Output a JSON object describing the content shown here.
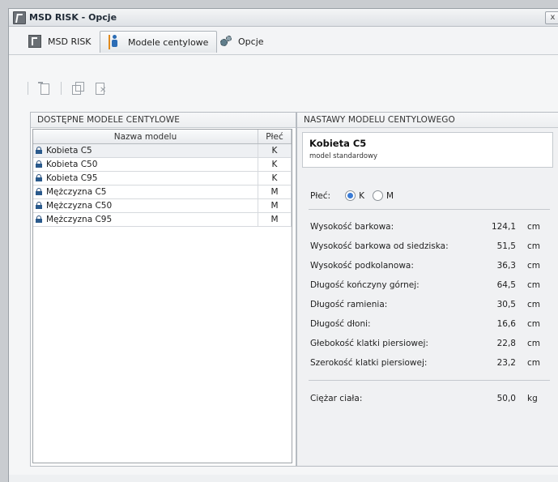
{
  "window": {
    "title": "MSD RISK - Opcje",
    "close_label": "x"
  },
  "tabs": [
    {
      "label": "MSD RISK",
      "icon": "msd-risk-icon"
    },
    {
      "label": "Modele centylowe",
      "icon": "model-icon"
    },
    {
      "label": "Opcje",
      "icon": "gears-icon"
    }
  ],
  "toolbar": {
    "icons": [
      "new-model-icon",
      "copy-icon",
      "delete-icon"
    ]
  },
  "left_panel": {
    "title": "DOSTĘPNE MODELE CENTYLOWE",
    "columns": [
      "Nazwa modelu",
      "Płeć"
    ],
    "rows": [
      {
        "name": "Kobieta C5",
        "sex": "K"
      },
      {
        "name": "Kobieta C50",
        "sex": "K"
      },
      {
        "name": "Kobieta C95",
        "sex": "K"
      },
      {
        "name": "Mężczyzna C5",
        "sex": "M"
      },
      {
        "name": "Mężczyzna C50",
        "sex": "M"
      },
      {
        "name": "Mężczyzna C95",
        "sex": "M"
      }
    ]
  },
  "right_panel": {
    "title": "NASTAWY MODELU CENTYLOWEGO",
    "model_name": "Kobieta C5",
    "model_desc": "model standardowy",
    "sex_label": "Płeć:",
    "sex_options": [
      "K",
      "M"
    ],
    "sex_selected": "K",
    "measurements": [
      {
        "label": "Wysokość barkowa:",
        "value": "124,1",
        "unit": "cm"
      },
      {
        "label": "Wysokość barkowa od siedziska:",
        "value": "51,5",
        "unit": "cm"
      },
      {
        "label": "Wysokość podkolanowa:",
        "value": "36,3",
        "unit": "cm"
      },
      {
        "label": "Długość kończyny górnej:",
        "value": "64,5",
        "unit": "cm"
      },
      {
        "label": "Długość ramienia:",
        "value": "30,5",
        "unit": "cm"
      },
      {
        "label": "Długość dłoni:",
        "value": "16,6",
        "unit": "cm"
      },
      {
        "label": "Głebokość klatki piersiowej:",
        "value": "22,8",
        "unit": "cm"
      },
      {
        "label": "Szerokość klatki piersiowej:",
        "value": "23,2",
        "unit": "cm"
      }
    ],
    "weight": {
      "label": "Ciężar ciała:",
      "value": "50,0",
      "unit": "kg"
    }
  }
}
